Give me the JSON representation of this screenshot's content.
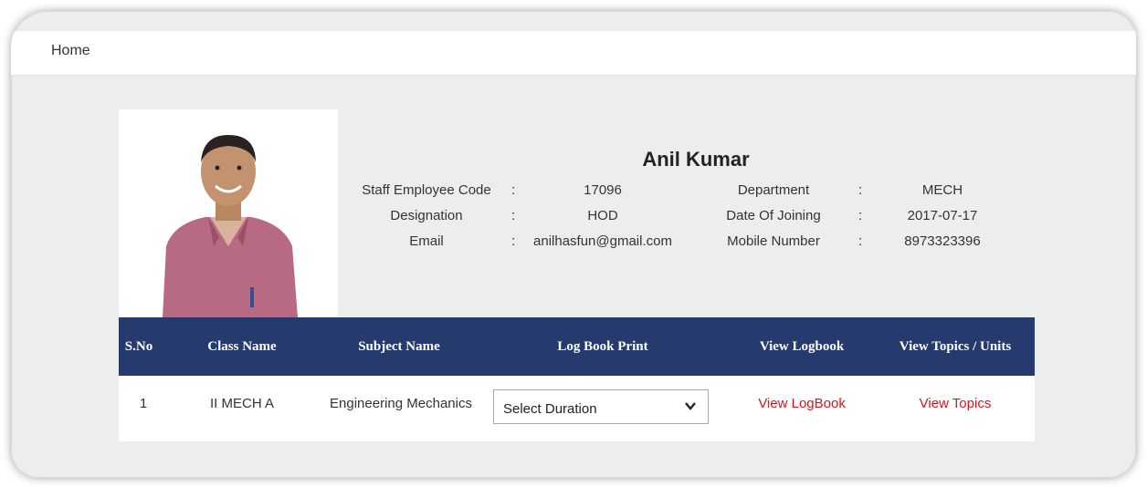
{
  "breadcrumb": {
    "home": "Home"
  },
  "profile": {
    "name": "Anil Kumar",
    "fields_left": [
      {
        "label": "Staff Employee Code",
        "sep": ":",
        "value": "17096"
      },
      {
        "label": "Designation",
        "sep": ":",
        "value": "HOD"
      },
      {
        "label": "Email",
        "sep": ":",
        "value": "anilhasfun@gmail.com"
      }
    ],
    "fields_right": [
      {
        "label": "Department",
        "sep": ":",
        "value": "MECH"
      },
      {
        "label": "Date Of Joining",
        "sep": ":",
        "value": "2017-07-17"
      },
      {
        "label": "Mobile Number",
        "sep": ":",
        "value": "8973323396"
      }
    ]
  },
  "table": {
    "headers": [
      "S.No",
      "Class Name",
      "Subject Name",
      "Log Book Print",
      "View Logbook",
      "View Topics / Units"
    ],
    "rows": [
      {
        "sno": "1",
        "class_name": "II MECH A",
        "subject": "Engineering Mechanics",
        "duration_selected": "Select Duration",
        "view_logbook": "View LogBook",
        "view_topics": "View Topics"
      }
    ]
  },
  "colors": {
    "header_bg": "#263a6e",
    "link": "#e0121b",
    "page_bg": "#eceeed"
  }
}
